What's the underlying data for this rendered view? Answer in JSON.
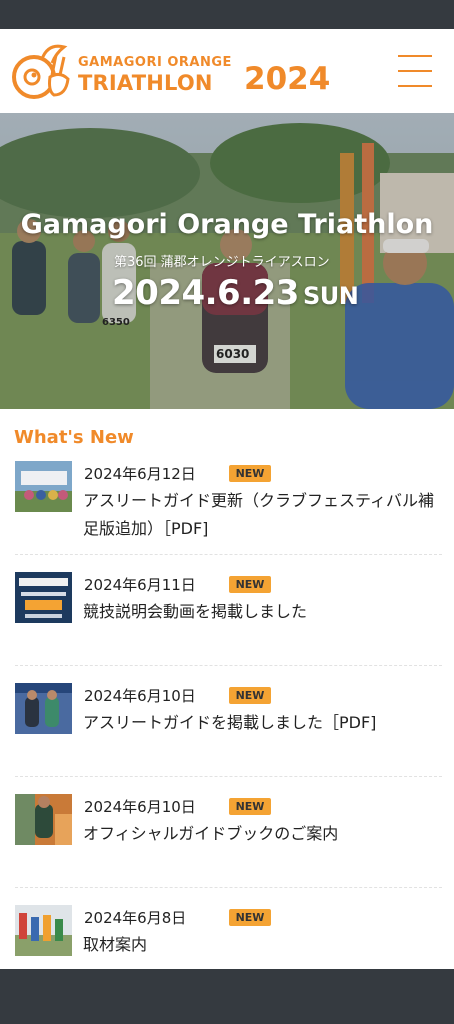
{
  "header": {
    "logo_top": "Gamagori Orange",
    "logo_main": "TRIATHLON",
    "logo_year": "2024",
    "menu_icon": "hamburger-menu-icon"
  },
  "hero": {
    "title": "Gamagori Orange Triathlon",
    "subtitle": "第36回 蒲郡オレンジトライアスロン",
    "date": "2024.6.23",
    "day_of_week": "SUN",
    "runner_bib_1": "6030",
    "runner_bib_2": "6350"
  },
  "news": {
    "heading": "What's New",
    "items": [
      {
        "date": "2024年6月12日",
        "badge": "NEW",
        "title": "アスリートガイド更新（クラブフェスティバル補足版追加）［PDF]"
      },
      {
        "date": "2024年6月11日",
        "badge": "NEW",
        "title": "競技説明会動画を掲載しました"
      },
      {
        "date": "2024年6月10日",
        "badge": "NEW",
        "title": "アスリートガイドを掲載しました［PDF]"
      },
      {
        "date": "2024年6月10日",
        "badge": "NEW",
        "title": "オフィシャルガイドブックのご案内"
      },
      {
        "date": "2024年6月8日",
        "badge": "NEW",
        "title": "取材案内"
      }
    ]
  },
  "colors": {
    "accent": "#f08a2a",
    "badge": "#f4a333",
    "system_bar": "#353a40"
  }
}
